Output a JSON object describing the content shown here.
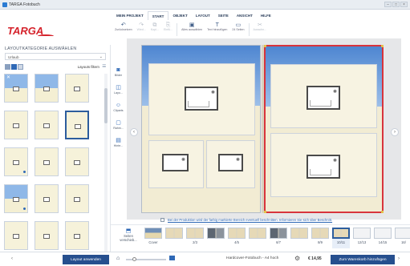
{
  "window": {
    "title": "TARGA Fotobuch"
  },
  "logo": {
    "text": "TARGA"
  },
  "menu": {
    "tabs": [
      "MEIN PROJEKT",
      "START",
      "OBJEKT",
      "LAYOUT",
      "SEITE",
      "ANSICHT",
      "HILFE"
    ],
    "active_index": 1
  },
  "toolbar": {
    "items": [
      {
        "icon": "undo-icon",
        "label": "Zurücksetzen",
        "enabled": true
      },
      {
        "icon": "redo-icon",
        "label": "Wied...",
        "enabled": false
      },
      {
        "icon": "copy-icon",
        "label": "Kopi...",
        "enabled": false
      },
      {
        "icon": "paste-icon",
        "label": "Einfü...",
        "enabled": false
      },
      {
        "icon": "select-all-icon",
        "label": "Alles auswählen",
        "enabled": true
      },
      {
        "icon": "add-text-icon",
        "label": "Text hinzufügen",
        "enabled": true
      },
      {
        "icon": "pages-icon",
        "label": "24 Seiten",
        "enabled": true
      },
      {
        "icon": "cut-icon",
        "label": "Ausschn...",
        "enabled": false
      }
    ]
  },
  "left_panel": {
    "heading": "LAYOUTKATEGORIE AUSWÄHLEN",
    "category_selected": "Urlaub",
    "filter_label": "Layouts filtern"
  },
  "side_tools": [
    {
      "icon": "camera-icon",
      "label": "Bilder"
    },
    {
      "icon": "layout-icon",
      "label": "Layo..."
    },
    {
      "icon": "cliparts-icon",
      "label": "Cliparts"
    },
    {
      "icon": "frame-icon",
      "label": "Rahm..."
    },
    {
      "icon": "background-icon",
      "label": "Hinte..."
    }
  ],
  "notice": {
    "text": "Bei der Produktion wird der farbig markierte Bereich eventuell beschnitten. Informieren Sie sich über Beschnitt."
  },
  "page_strip": {
    "action_label": "Seiten verschieb...",
    "items": [
      {
        "label": "Cover",
        "style": "cover"
      },
      {
        "label": "",
        "style": "normal"
      },
      {
        "label": "2/3",
        "style": "normal"
      },
      {
        "label": "",
        "style": "dark"
      },
      {
        "label": "4/5",
        "style": "normal"
      },
      {
        "label": "",
        "style": "normal"
      },
      {
        "label": "6/7",
        "style": "dark"
      },
      {
        "label": "",
        "style": "normal"
      },
      {
        "label": "8/9",
        "style": "normal"
      },
      {
        "label": "10/11",
        "style": "normal",
        "selected": true
      },
      {
        "label": "12/13",
        "style": "empty"
      },
      {
        "label": "14/15",
        "style": "empty"
      },
      {
        "label": "16/",
        "style": "empty"
      }
    ]
  },
  "bottom": {
    "apply_layout_label": "Layout anwenden",
    "product_label": "Hardcover-Fotobuch - A4 hoch",
    "price": "€ 14,95",
    "cart_label": "Zum Warenkorb hinzufügen"
  },
  "colors": {
    "accent": "#264f8e",
    "brand": "#d5232c",
    "trim": "#d8343c"
  }
}
